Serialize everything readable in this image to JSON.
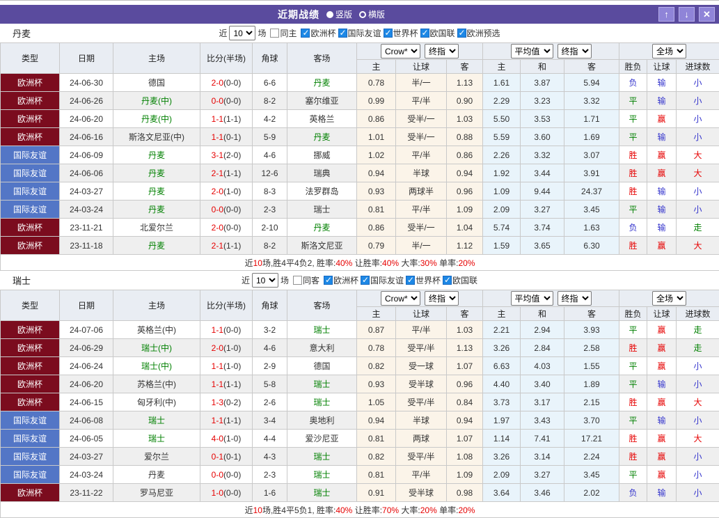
{
  "titlebar": {
    "title": "近期战绩",
    "vertical_label": "竖版",
    "horizontal_label": "横版",
    "up_icon": "↑",
    "down_icon": "↓",
    "close_icon": "✕"
  },
  "colors": {
    "titlebar_bg": "#5a4b9e",
    "euro_cup_bg": "#7b0c1e",
    "friendly_bg": "#5376c6",
    "score_red": "#e60000",
    "team_green": "#008000",
    "result_blue": "#3333cc",
    "handicap_odds_bg": "#fbf4e9",
    "average_odds_bg": "#e9f4fb"
  },
  "filters_common": {
    "near_label": "近",
    "count_value": "10",
    "games_label": "场"
  },
  "table_header": {
    "type": "类型",
    "date": "日期",
    "home": "主场",
    "score": "比分(半场)",
    "corner": "角球",
    "away": "客场",
    "bookmaker_value": "Crow*",
    "stage_value": "终指",
    "avg_value": "平均值",
    "avg_stage_value": "终指",
    "scope_value": "全场",
    "sub_headers": [
      "主",
      "让球",
      "客",
      "主",
      "和",
      "客",
      "胜负",
      "让球",
      "进球数"
    ]
  },
  "result_colors": {
    "胜": "red",
    "平": "green",
    "负": "blue",
    "赢": "red",
    "输": "blue",
    "走": "green",
    "大": "red",
    "小": "blue"
  },
  "sections": [
    {
      "team": "丹麦",
      "same_filter": {
        "label": "同主",
        "checked": false
      },
      "league_filters": [
        {
          "label": "欧洲杯",
          "checked": true
        },
        {
          "label": "国际友谊",
          "checked": true
        },
        {
          "label": "世界杯",
          "checked": true
        },
        {
          "label": "欧国联",
          "checked": true
        },
        {
          "label": "欧洲预选",
          "checked": true
        }
      ],
      "rows": [
        {
          "type": "欧洲杯",
          "date": "24-06-30",
          "home": "德国",
          "home_green": false,
          "score": "2-0",
          "half": "(0-0)",
          "corner": "6-6",
          "away": "丹麦",
          "away_green": true,
          "odds": [
            "0.78",
            "半/一",
            "1.13"
          ],
          "avg": [
            "1.61",
            "3.87",
            "5.94"
          ],
          "results": [
            "负",
            "输",
            "小"
          ]
        },
        {
          "type": "欧洲杯",
          "date": "24-06-26",
          "home": "丹麦(中)",
          "home_green": true,
          "score": "0-0",
          "half": "(0-0)",
          "corner": "8-2",
          "away": "塞尔维亚",
          "away_green": false,
          "odds": [
            "0.99",
            "平/半",
            "0.90"
          ],
          "avg": [
            "2.29",
            "3.23",
            "3.32"
          ],
          "results": [
            "平",
            "输",
            "小"
          ]
        },
        {
          "type": "欧洲杯",
          "date": "24-06-20",
          "home": "丹麦(中)",
          "home_green": true,
          "score": "1-1",
          "half": "(1-1)",
          "corner": "4-2",
          "away": "英格兰",
          "away_green": false,
          "odds": [
            "0.86",
            "受半/一",
            "1.03"
          ],
          "avg": [
            "5.50",
            "3.53",
            "1.71"
          ],
          "results": [
            "平",
            "赢",
            "小"
          ]
        },
        {
          "type": "欧洲杯",
          "date": "24-06-16",
          "home": "斯洛文尼亚(中)",
          "home_green": false,
          "score": "1-1",
          "half": "(0-1)",
          "corner": "5-9",
          "away": "丹麦",
          "away_green": true,
          "odds": [
            "1.01",
            "受半/一",
            "0.88"
          ],
          "avg": [
            "5.59",
            "3.60",
            "1.69"
          ],
          "results": [
            "平",
            "输",
            "小"
          ]
        },
        {
          "type": "国际友谊",
          "date": "24-06-09",
          "home": "丹麦",
          "home_green": true,
          "score": "3-1",
          "half": "(2-0)",
          "corner": "4-6",
          "away": "挪威",
          "away_green": false,
          "odds": [
            "1.02",
            "平/半",
            "0.86"
          ],
          "avg": [
            "2.26",
            "3.32",
            "3.07"
          ],
          "results": [
            "胜",
            "赢",
            "大"
          ]
        },
        {
          "type": "国际友谊",
          "date": "24-06-06",
          "home": "丹麦",
          "home_green": true,
          "score": "2-1",
          "half": "(1-1)",
          "corner": "12-6",
          "away": "瑞典",
          "away_green": false,
          "odds": [
            "0.94",
            "半球",
            "0.94"
          ],
          "avg": [
            "1.92",
            "3.44",
            "3.91"
          ],
          "results": [
            "胜",
            "赢",
            "大"
          ]
        },
        {
          "type": "国际友谊",
          "date": "24-03-27",
          "home": "丹麦",
          "home_green": true,
          "score": "2-0",
          "half": "(1-0)",
          "corner": "8-3",
          "away": "法罗群岛",
          "away_green": false,
          "odds": [
            "0.93",
            "两球半",
            "0.96"
          ],
          "avg": [
            "1.09",
            "9.44",
            "24.37"
          ],
          "results": [
            "胜",
            "输",
            "小"
          ]
        },
        {
          "type": "国际友谊",
          "date": "24-03-24",
          "home": "丹麦",
          "home_green": true,
          "score": "0-0",
          "half": "(0-0)",
          "corner": "2-3",
          "away": "瑞士",
          "away_green": false,
          "odds": [
            "0.81",
            "平/半",
            "1.09"
          ],
          "avg": [
            "2.09",
            "3.27",
            "3.45"
          ],
          "results": [
            "平",
            "输",
            "小"
          ]
        },
        {
          "type": "欧洲杯",
          "date": "23-11-21",
          "home": "北爱尔兰",
          "home_green": false,
          "score": "2-0",
          "half": "(0-0)",
          "corner": "2-10",
          "away": "丹麦",
          "away_green": true,
          "odds": [
            "0.86",
            "受半/一",
            "1.04"
          ],
          "avg": [
            "5.74",
            "3.74",
            "1.63"
          ],
          "results": [
            "负",
            "输",
            "走"
          ]
        },
        {
          "type": "欧洲杯",
          "date": "23-11-18",
          "home": "丹麦",
          "home_green": true,
          "score": "2-1",
          "half": "(1-1)",
          "corner": "8-2",
          "away": "斯洛文尼亚",
          "away_green": false,
          "odds": [
            "0.79",
            "半/一",
            "1.12"
          ],
          "avg": [
            "1.59",
            "3.65",
            "6.30"
          ],
          "results": [
            "胜",
            "赢",
            "大"
          ]
        }
      ],
      "summary": [
        {
          "text": "近",
          "red": false
        },
        {
          "text": "10",
          "red": true
        },
        {
          "text": "场,胜4平4负2, 胜率:",
          "red": false
        },
        {
          "text": "40%",
          "red": true
        },
        {
          "text": " 让胜率:",
          "red": false
        },
        {
          "text": "40%",
          "red": true
        },
        {
          "text": " 大率:",
          "red": false
        },
        {
          "text": "30%",
          "red": true
        },
        {
          "text": " 单率:",
          "red": false
        },
        {
          "text": "20%",
          "red": true
        }
      ]
    },
    {
      "team": "瑞士",
      "same_filter": {
        "label": "同客",
        "checked": false
      },
      "league_filters": [
        {
          "label": "欧洲杯",
          "checked": true
        },
        {
          "label": "国际友谊",
          "checked": true
        },
        {
          "label": "世界杯",
          "checked": true
        },
        {
          "label": "欧国联",
          "checked": true
        }
      ],
      "rows": [
        {
          "type": "欧洲杯",
          "date": "24-07-06",
          "home": "英格兰(中)",
          "home_green": false,
          "score": "1-1",
          "half": "(0-0)",
          "corner": "3-2",
          "away": "瑞士",
          "away_green": true,
          "odds": [
            "0.87",
            "平/半",
            "1.03"
          ],
          "avg": [
            "2.21",
            "2.94",
            "3.93"
          ],
          "results": [
            "平",
            "赢",
            "走"
          ]
        },
        {
          "type": "欧洲杯",
          "date": "24-06-29",
          "home": "瑞士(中)",
          "home_green": true,
          "score": "2-0",
          "half": "(1-0)",
          "corner": "4-6",
          "away": "意大利",
          "away_green": false,
          "odds": [
            "0.78",
            "受平/半",
            "1.13"
          ],
          "avg": [
            "3.26",
            "2.84",
            "2.58"
          ],
          "results": [
            "胜",
            "赢",
            "走"
          ]
        },
        {
          "type": "欧洲杯",
          "date": "24-06-24",
          "home": "瑞士(中)",
          "home_green": true,
          "score": "1-1",
          "half": "(1-0)",
          "corner": "2-9",
          "away": "德国",
          "away_green": false,
          "odds": [
            "0.82",
            "受一球",
            "1.07"
          ],
          "avg": [
            "6.63",
            "4.03",
            "1.55"
          ],
          "results": [
            "平",
            "赢",
            "小"
          ]
        },
        {
          "type": "欧洲杯",
          "date": "24-06-20",
          "home": "苏格兰(中)",
          "home_green": false,
          "score": "1-1",
          "half": "(1-1)",
          "corner": "5-8",
          "away": "瑞士",
          "away_green": true,
          "odds": [
            "0.93",
            "受半球",
            "0.96"
          ],
          "avg": [
            "4.40",
            "3.40",
            "1.89"
          ],
          "results": [
            "平",
            "输",
            "小"
          ]
        },
        {
          "type": "欧洲杯",
          "date": "24-06-15",
          "home": "匈牙利(中)",
          "home_green": false,
          "score": "1-3",
          "half": "(0-2)",
          "corner": "2-6",
          "away": "瑞士",
          "away_green": true,
          "odds": [
            "1.05",
            "受平/半",
            "0.84"
          ],
          "avg": [
            "3.73",
            "3.17",
            "2.15"
          ],
          "results": [
            "胜",
            "赢",
            "大"
          ]
        },
        {
          "type": "国际友谊",
          "date": "24-06-08",
          "home": "瑞士",
          "home_green": true,
          "score": "1-1",
          "half": "(1-1)",
          "corner": "3-4",
          "away": "奥地利",
          "away_green": false,
          "odds": [
            "0.94",
            "半球",
            "0.94"
          ],
          "avg": [
            "1.97",
            "3.43",
            "3.70"
          ],
          "results": [
            "平",
            "输",
            "小"
          ]
        },
        {
          "type": "国际友谊",
          "date": "24-06-05",
          "home": "瑞士",
          "home_green": true,
          "score": "4-0",
          "half": "(1-0)",
          "corner": "4-4",
          "away": "爱沙尼亚",
          "away_green": false,
          "odds": [
            "0.81",
            "两球",
            "1.07"
          ],
          "avg": [
            "1.14",
            "7.41",
            "17.21"
          ],
          "results": [
            "胜",
            "赢",
            "大"
          ]
        },
        {
          "type": "国际友谊",
          "date": "24-03-27",
          "home": "爱尔兰",
          "home_green": false,
          "score": "0-1",
          "half": "(0-1)",
          "corner": "4-3",
          "away": "瑞士",
          "away_green": true,
          "odds": [
            "0.82",
            "受平/半",
            "1.08"
          ],
          "avg": [
            "3.26",
            "3.14",
            "2.24"
          ],
          "results": [
            "胜",
            "赢",
            "小"
          ]
        },
        {
          "type": "国际友谊",
          "date": "24-03-24",
          "home": "丹麦",
          "home_green": false,
          "score": "0-0",
          "half": "(0-0)",
          "corner": "2-3",
          "away": "瑞士",
          "away_green": true,
          "odds": [
            "0.81",
            "平/半",
            "1.09"
          ],
          "avg": [
            "2.09",
            "3.27",
            "3.45"
          ],
          "results": [
            "平",
            "赢",
            "小"
          ]
        },
        {
          "type": "欧洲杯",
          "date": "23-11-22",
          "home": "罗马尼亚",
          "home_green": false,
          "score": "1-0",
          "half": "(0-0)",
          "corner": "1-6",
          "away": "瑞士",
          "away_green": true,
          "odds": [
            "0.91",
            "受半球",
            "0.98"
          ],
          "avg": [
            "3.64",
            "3.46",
            "2.02"
          ],
          "results": [
            "负",
            "输",
            "小"
          ]
        }
      ],
      "summary": [
        {
          "text": "近",
          "red": false
        },
        {
          "text": "10",
          "red": true
        },
        {
          "text": "场,胜4平5负1, 胜率:",
          "red": false
        },
        {
          "text": "40%",
          "red": true
        },
        {
          "text": " 让胜率:",
          "red": false
        },
        {
          "text": "70%",
          "red": true
        },
        {
          "text": " 大率:",
          "red": false
        },
        {
          "text": "20%",
          "red": true
        },
        {
          "text": " 单率:",
          "red": false
        },
        {
          "text": "20%",
          "red": true
        }
      ]
    }
  ]
}
